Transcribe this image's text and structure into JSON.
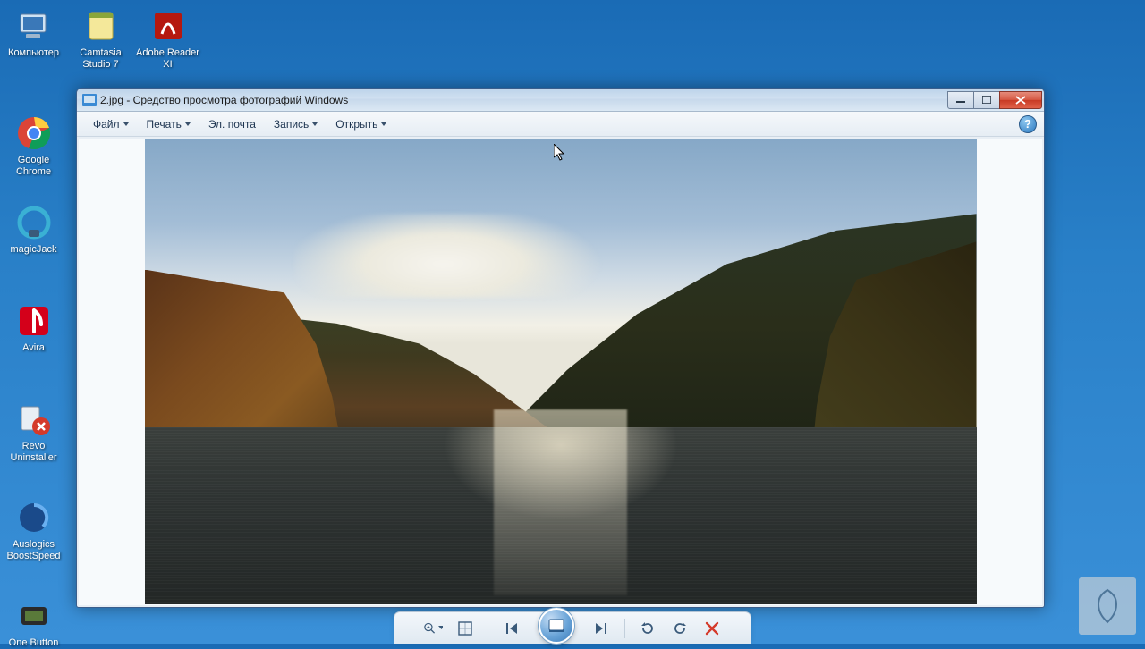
{
  "desktop_icons": [
    {
      "label": "Компьютер"
    },
    {
      "label": "Camtasia Studio 7"
    },
    {
      "label": "Adobe Reader XI"
    },
    {
      "label": "Google Chrome"
    },
    {
      "label": "magicJack"
    },
    {
      "label": "Avira"
    },
    {
      "label": "Revo Uninstaller"
    },
    {
      "label": "Auslogics BoostSpeed"
    },
    {
      "label": "One Button"
    }
  ],
  "window": {
    "title": "2.jpg - Средство просмотра фотографий Windows"
  },
  "menu": {
    "file": "Файл",
    "print": "Печать",
    "email": "Эл. почта",
    "burn": "Запись",
    "open": "Открыть"
  },
  "help_glyph": "?"
}
